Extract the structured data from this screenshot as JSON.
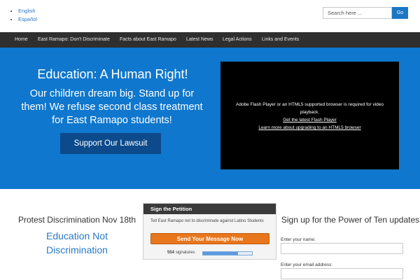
{
  "languages": [
    "English",
    "Español"
  ],
  "search": {
    "placeholder": "Search here ...",
    "button": "Go"
  },
  "nav": [
    "Home",
    "East Ramapo: Don't Discriminate",
    "Facts about East Ramapo",
    "Latest News",
    "Legal Actions",
    "Links and Events"
  ],
  "hero": {
    "title": "Education: A Human Right!",
    "subtitle": "Our children dream big. Stand up for them! We refuse second class treatment for East Ramapo students!",
    "button": "Support Our Lawsuit",
    "video": {
      "message": "Adobe Flash Player or an HTML5 supported browser is required for video playback.",
      "link1": "Get the latest Flash Player",
      "link2": "Learn more about upgrading to an HTML5 browser"
    }
  },
  "left": {
    "protest": "Protest Discrimination Nov 18th",
    "edu_line1": "Education Not",
    "edu_line2": "Discrimination"
  },
  "petition": {
    "header": "Sign the Petition",
    "text": "Tell East Ramapo not to discriminate against Latino Students",
    "button": "Send Your Message Now",
    "count": "554",
    "count_label": "signatures",
    "progress": 0.72
  },
  "signup": {
    "title": "Sign up for the Power of Ten updates",
    "name_label": "Enter your name:",
    "email_label": "Enter your email address:"
  },
  "colors": {
    "hero_bg": "#0f77cd",
    "nav_bg": "#2f2f2f",
    "button_dark": "#0c4a8b",
    "petition_button": "#e8761c",
    "link": "#2a7ac8"
  }
}
